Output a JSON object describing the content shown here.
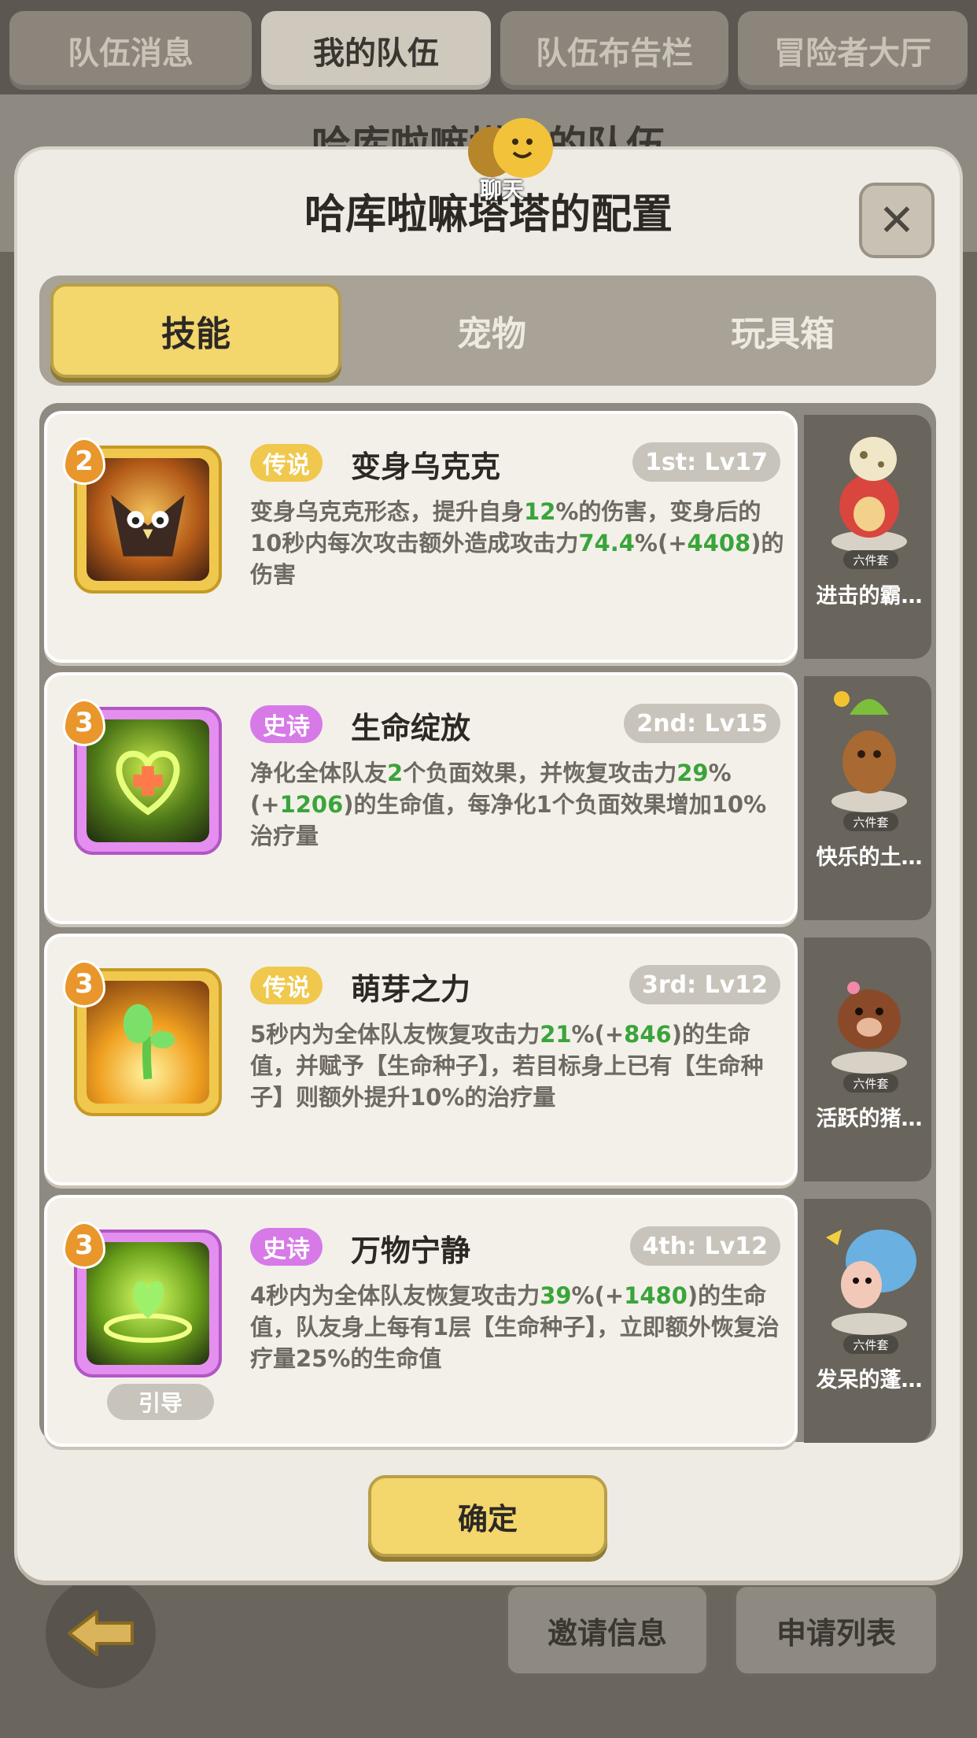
{
  "top_tabs": [
    "队伍消息",
    "我的队伍",
    "队伍布告栏",
    "冒险者大厅"
  ],
  "bg_title": "哈库啦嘛塔塔的队伍",
  "bottom": {
    "invite": "邀请信息",
    "apply": "申请列表"
  },
  "modal": {
    "title": "哈库啦嘛塔塔的配置",
    "chat_label": "聊天",
    "close": "✕",
    "tabs": [
      "技能",
      "宠物",
      "玩具箱"
    ],
    "confirm": "确定"
  },
  "skills": [
    {
      "level": "2",
      "rarity": "传说",
      "name": "变身乌克克",
      "slot": "1st: Lv17",
      "desc_parts": [
        "变身乌克克形态，提升自身",
        "12",
        "%的伤害，变身后的10秒内每次攻击额外造成攻击力",
        "74.4",
        "%(+",
        "4408",
        ")的伤害"
      ],
      "pet": "进击的霸…",
      "set": "六件套"
    },
    {
      "level": "3",
      "rarity": "史诗",
      "name": "生命绽放",
      "slot": "2nd: Lv15",
      "desc_parts": [
        "净化全体队友",
        "2",
        "个负面效果，并恢复攻击力",
        "29",
        "%(+",
        "1206",
        ")的生命值，每净化1个负面效果增加10%治疗量"
      ],
      "pet": "快乐的土…",
      "set": "六件套"
    },
    {
      "level": "3",
      "rarity": "传说",
      "name": "萌芽之力",
      "slot": "3rd: Lv12",
      "desc_parts": [
        "5秒内为全体队友恢复攻击力",
        "21",
        "%(+",
        "846",
        ")的生命值，并赋予【生命种子】，若目标身上已有【生命种子】则额外提升10%的治疗量"
      ],
      "pet": "活跃的猪…",
      "set": "六件套"
    },
    {
      "level": "3",
      "rarity": "史诗",
      "name": "万物宁静",
      "slot": "4th: Lv12",
      "desc_parts": [
        "4秒内为全体队友恢复攻击力",
        "39",
        "%(+",
        "1480",
        ")的生命值，队友身上每有1层【生命种子】，立即额外恢复治疗量25%的生命值"
      ],
      "guide": "引导",
      "pet": "发呆的蓬…",
      "set": "六件套"
    }
  ],
  "colors": {
    "accent": "#f3d66c",
    "legend": "#f0c84e",
    "epic": "#d77ae8",
    "highlight": "#3aa43a"
  }
}
